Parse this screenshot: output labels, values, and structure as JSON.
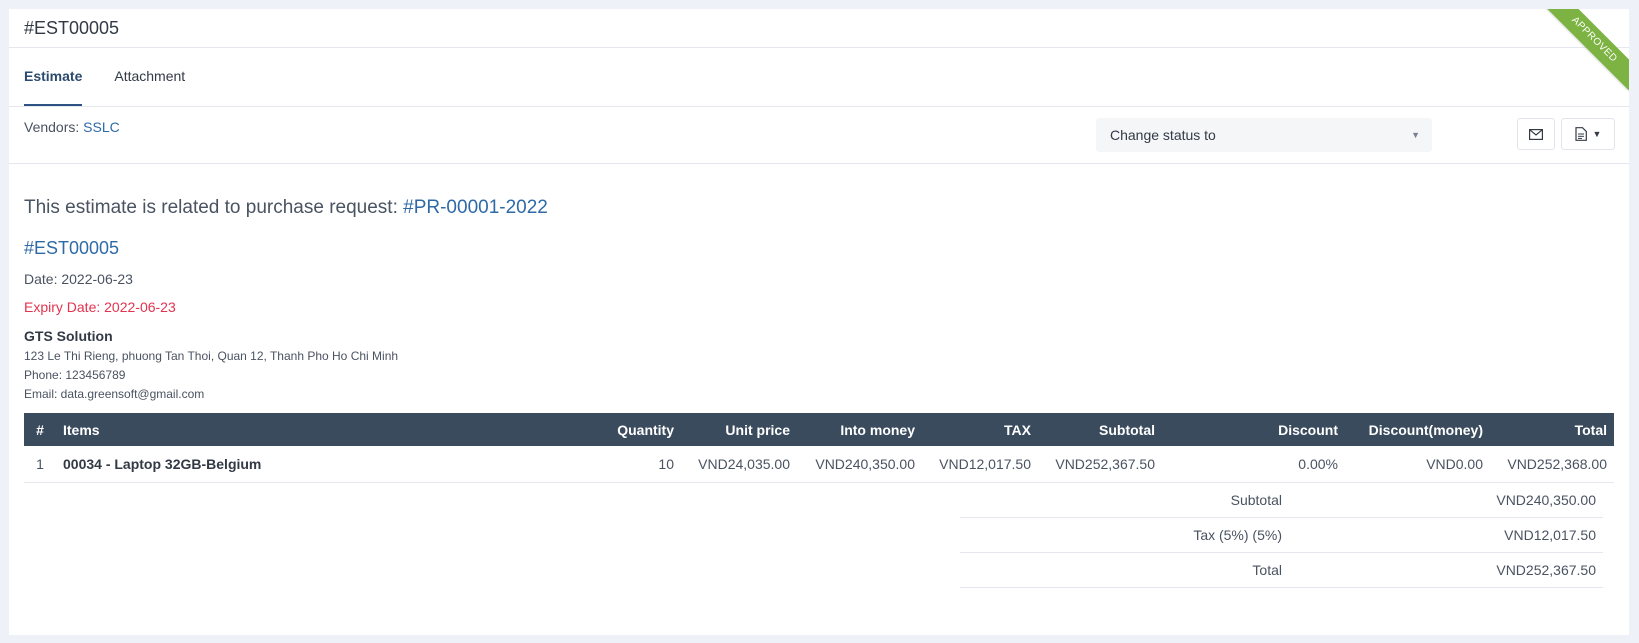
{
  "header": {
    "title": "#EST00005",
    "ribbon": "APPROVED"
  },
  "tabs": [
    {
      "label": "Estimate",
      "active": true
    },
    {
      "label": "Attachment",
      "active": false
    }
  ],
  "toolbar": {
    "vendors_label": "Vendors:",
    "vendor_name": "SSLC",
    "status_select_value": "Change status to"
  },
  "estimate": {
    "related_text": "This estimate is related to purchase request:",
    "related_link": "#PR-00001-2022",
    "number": "#EST00005",
    "date": "Date: 2022-06-23",
    "expiry": "Expiry Date: 2022-06-23",
    "company": "GTS Solution",
    "address": "123 Le Thi Rieng, phuong Tan Thoi, Quan 12, Thanh Pho Ho Chi Minh",
    "phone": "Phone: 123456789",
    "email": "Email: data.greensoft@gmail.com"
  },
  "table": {
    "headers": [
      "#",
      "Items",
      "Quantity",
      "Unit price",
      "Into money",
      "TAX",
      "Subtotal",
      "Discount",
      "Discount(money)",
      "Total"
    ],
    "rows": [
      [
        "1",
        "00034 - Laptop 32GB-Belgium",
        "10",
        "VND24,035.00",
        "VND240,350.00",
        "VND12,017.50",
        "VND252,367.50",
        "0.00%",
        "VND0.00",
        "VND252,368.00"
      ]
    ]
  },
  "totals": [
    {
      "label": "Subtotal",
      "value": "VND240,350.00"
    },
    {
      "label": "Tax (5%) (5%)",
      "value": "VND12,017.50"
    },
    {
      "label": "Total",
      "value": "VND252,367.50"
    }
  ],
  "colors": {
    "accent": "#2f6aa6",
    "header_bg": "#3b4b5e",
    "ribbon": "#7cb342",
    "expiry": "#e3334f"
  },
  "icons": {
    "mail": "mail-icon",
    "pdf": "file-pdf-icon",
    "dropdown": "caret-down-icon"
  }
}
